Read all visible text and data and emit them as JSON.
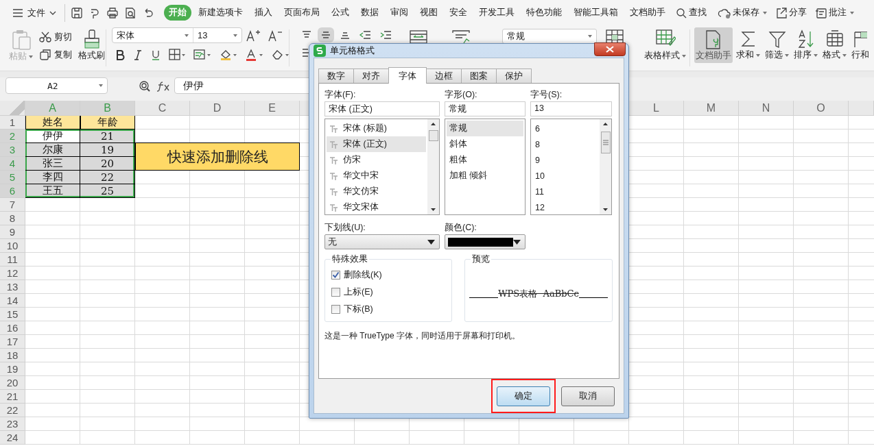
{
  "menu_bar": {
    "file_menu": "文件",
    "tabs": [
      {
        "label": "开始",
        "selected": true
      },
      {
        "label": "新建选项卡",
        "selected": false
      },
      {
        "label": "插入",
        "selected": false
      },
      {
        "label": "页面布局",
        "selected": false
      },
      {
        "label": "公式",
        "selected": false
      },
      {
        "label": "数据",
        "selected": false
      },
      {
        "label": "审阅",
        "selected": false
      },
      {
        "label": "视图",
        "selected": false
      },
      {
        "label": "安全",
        "selected": false
      },
      {
        "label": "开发工具",
        "selected": false
      },
      {
        "label": "特色功能",
        "selected": false
      },
      {
        "label": "智能工具箱",
        "selected": false
      },
      {
        "label": "文档助手",
        "selected": false
      }
    ],
    "search": "查找",
    "save_status": "未保存",
    "share": "分享",
    "comment": "批注"
  },
  "ribbon": {
    "paste": {
      "label": "粘贴",
      "disabled": true
    },
    "cut": "剪切",
    "copy": "复制",
    "format_painter": "格式刷",
    "font_name": "宋体",
    "font_size": "13",
    "number_format": "常规",
    "table_style": "表格样式",
    "tools": [
      {
        "kind": "assistant",
        "label": "文档助手",
        "selected": true
      },
      {
        "kind": "sum",
        "label": "求和",
        "selected": false
      },
      {
        "kind": "filter",
        "label": "筛选",
        "selected": false
      },
      {
        "kind": "sort",
        "label": "排序",
        "selected": false
      },
      {
        "kind": "format",
        "label": "格式",
        "selected": false
      },
      {
        "kind": "rowcol",
        "label": "行和",
        "selected": false
      }
    ]
  },
  "formula_bar": {
    "name_box": "A2",
    "value": "伊伊"
  },
  "sheet": {
    "columns": [
      {
        "label": "A",
        "selected": true
      },
      {
        "label": "B",
        "selected": true
      },
      {
        "label": "C",
        "selected": false
      },
      {
        "label": "D",
        "selected": false
      },
      {
        "label": "E",
        "selected": false
      },
      {
        "label": "L",
        "selected": false
      },
      {
        "label": "M",
        "selected": false
      },
      {
        "label": "N",
        "selected": false
      },
      {
        "label": "O",
        "selected": false
      }
    ],
    "row_numbers": [
      {
        "label": "1",
        "selected": false
      },
      {
        "label": "2",
        "selected": true
      },
      {
        "label": "3",
        "selected": true
      },
      {
        "label": "4",
        "selected": true
      },
      {
        "label": "5",
        "selected": true
      },
      {
        "label": "6",
        "selected": true
      },
      {
        "label": "7",
        "selected": false
      },
      {
        "label": "8",
        "selected": false
      },
      {
        "label": "9",
        "selected": false
      },
      {
        "label": "10",
        "selected": false
      },
      {
        "label": "11",
        "selected": false
      },
      {
        "label": "12",
        "selected": false
      },
      {
        "label": "13",
        "selected": false
      },
      {
        "label": "14",
        "selected": false
      },
      {
        "label": "15",
        "selected": false
      },
      {
        "label": "16",
        "selected": false
      },
      {
        "label": "17",
        "selected": false
      },
      {
        "label": "18",
        "selected": false
      },
      {
        "label": "19",
        "selected": false
      },
      {
        "label": "20",
        "selected": false
      },
      {
        "label": "21",
        "selected": false
      },
      {
        "label": "22",
        "selected": false
      },
      {
        "label": "23",
        "selected": false
      },
      {
        "label": "24",
        "selected": false
      }
    ],
    "rows": [
      {
        "kind": "header",
        "cells": [
          {
            "text": "姓名",
            "selected": false,
            "active": false
          },
          {
            "text": "年龄",
            "selected": false,
            "active": false
          }
        ]
      },
      {
        "kind": "data",
        "cells": [
          {
            "text": "伊伊",
            "selected": true,
            "active": true
          },
          {
            "text": "21",
            "selected": true,
            "active": false
          }
        ]
      },
      {
        "kind": "data",
        "cells": [
          {
            "text": "尔康",
            "selected": true,
            "active": false
          },
          {
            "text": "19",
            "selected": true,
            "active": false
          }
        ]
      },
      {
        "kind": "data",
        "cells": [
          {
            "text": "张三",
            "selected": true,
            "active": false
          },
          {
            "text": "20",
            "selected": true,
            "active": false
          }
        ]
      },
      {
        "kind": "data",
        "cells": [
          {
            "text": "李四",
            "selected": true,
            "active": false
          },
          {
            "text": "22",
            "selected": true,
            "active": false
          }
        ]
      },
      {
        "kind": "data",
        "cells": [
          {
            "text": "王五",
            "selected": true,
            "active": false
          },
          {
            "text": "25",
            "selected": true,
            "active": false
          }
        ]
      }
    ],
    "banner": "快速添加删除线"
  },
  "dialog": {
    "title": "单元格格式",
    "tabs": [
      {
        "label": "数字",
        "selected": false
      },
      {
        "label": "对齐",
        "selected": false
      },
      {
        "label": "字体",
        "selected": true
      },
      {
        "label": "边框",
        "selected": false
      },
      {
        "label": "图案",
        "selected": false
      },
      {
        "label": "保护",
        "selected": false
      }
    ],
    "font_label": "字体(F):",
    "font_value": "宋体 (正文)",
    "font_list": [
      {
        "label": "宋体 (标题)",
        "selected": false
      },
      {
        "label": "宋体 (正文)",
        "selected": true
      },
      {
        "label": "仿宋",
        "selected": false
      },
      {
        "label": "华文中宋",
        "selected": false
      },
      {
        "label": "华文仿宋",
        "selected": false
      },
      {
        "label": "华文宋体",
        "selected": false
      }
    ],
    "style_label": "字形(O):",
    "style_value": "常规",
    "style_list": [
      {
        "label": "常规",
        "selected": true
      },
      {
        "label": "斜体",
        "selected": false
      },
      {
        "label": "粗体",
        "selected": false
      },
      {
        "label": "加粗 倾斜",
        "selected": false
      }
    ],
    "size_label": "字号(S):",
    "size_value": "13",
    "size_list": [
      {
        "label": "6",
        "selected": false
      },
      {
        "label": "8",
        "selected": false
      },
      {
        "label": "9",
        "selected": false
      },
      {
        "label": "10",
        "selected": false
      },
      {
        "label": "11",
        "selected": false
      },
      {
        "label": "12",
        "selected": false
      }
    ],
    "underline_label": "下划线(U):",
    "underline_value": "无",
    "color_label": "颜色(C):",
    "color": "#000000",
    "effects_title": "特殊效果",
    "effects": [
      {
        "kind": "strikethrough",
        "label": "删除线(K)",
        "checked": true
      },
      {
        "kind": "superscript",
        "label": "上标(E)",
        "checked": false
      },
      {
        "kind": "subscript",
        "label": "下标(B)",
        "checked": false
      }
    ],
    "preview_title": "预览",
    "preview_text": "WPS表格  AaBbCc",
    "info": "这是一种 TrueType 字体，同时适用于屏幕和打印机。",
    "buttons": [
      {
        "label": "确定",
        "highlighted": true
      },
      {
        "label": "取消",
        "highlighted": false
      }
    ]
  }
}
